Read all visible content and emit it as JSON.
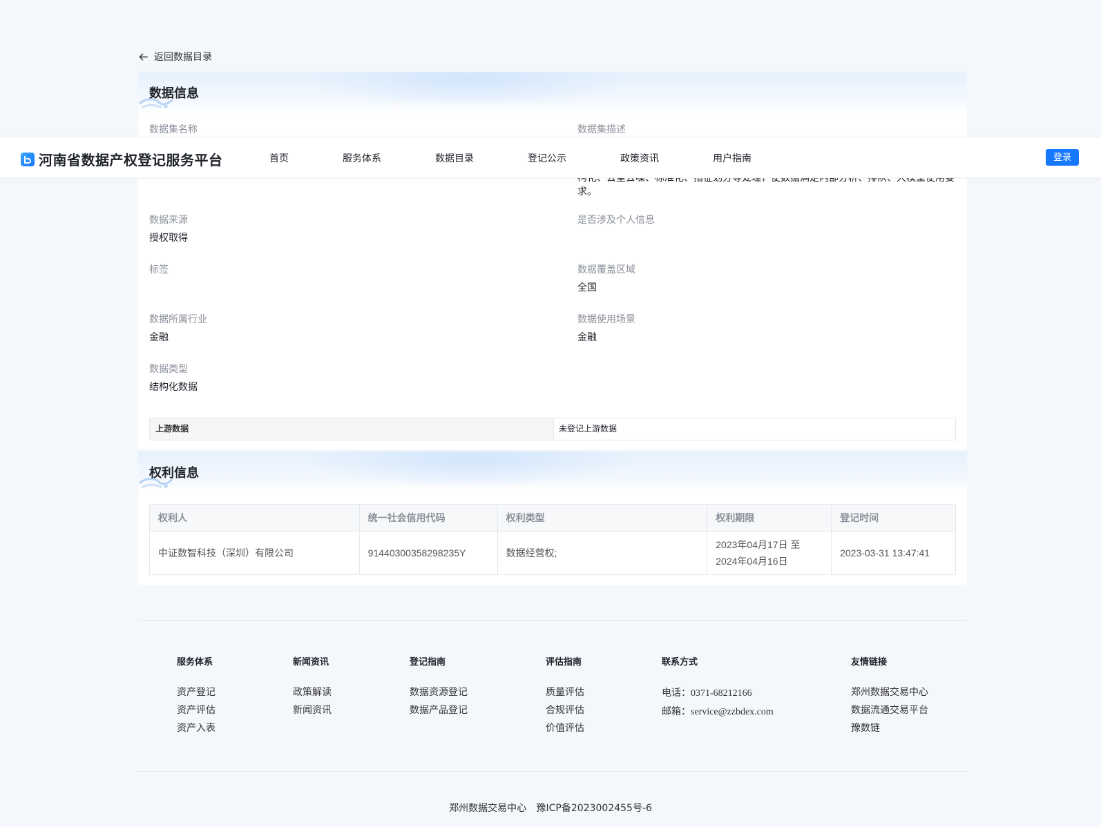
{
  "back_link": "返回数据目录",
  "data_info": {
    "title": "数据信息",
    "fields": {
      "name_label": "数据集名称",
      "desc_label": "数据集描述",
      "desc_text": "构化、去重去噪、标准化、指征划分等处理，使数据满足内部分析、排队、大模型使用要求。",
      "source_label": "数据来源",
      "source_value": "授权取得",
      "personal_label": "是否涉及个人信息",
      "tags_label": "标签",
      "region_label": "数据覆盖区域",
      "region_value": "全国",
      "industry_label": "数据所属行业",
      "industry_value": "金融",
      "scenario_label": "数据使用场景",
      "scenario_value": "金融",
      "type_label": "数据类型",
      "type_value": "结构化数据"
    },
    "upstream": {
      "label": "上游数据",
      "value": "未登记上游数据"
    }
  },
  "rights_info": {
    "title": "权利信息",
    "columns": [
      "权利人",
      "统一社会信用代码",
      "权利类型",
      "权利期限",
      "登记时间"
    ],
    "rows": [
      {
        "holder": "中证数智科技（深圳）有限公司",
        "credit_code": "91440300358298235Y",
        "right_type": "数据经营权;",
        "period_line1": "2023年04月17日 至",
        "period_line2": "2024年04月16日",
        "reg_time": "2023-03-31 13:47:41"
      }
    ]
  },
  "navbar": {
    "brand": "河南省数据产权登记服务平台",
    "items": [
      "首页",
      "服务体系",
      "数据目录",
      "登记公示",
      "政策资讯",
      "用户指南"
    ],
    "login": "登录",
    "accent": "#1677ff"
  },
  "footer": {
    "service": {
      "title": "服务体系",
      "items": [
        "资产登记",
        "资产评估",
        "资产入表"
      ]
    },
    "news": {
      "title": "新闻资讯",
      "items": [
        "政策解读",
        "新闻资讯"
      ]
    },
    "reg_guide": {
      "title": "登记指南",
      "items": [
        "数据资源登记",
        "数据产品登记"
      ]
    },
    "eval_guide": {
      "title": "评估指南",
      "items": [
        "质量评估",
        "合规评估",
        "价值评估"
      ]
    },
    "contact": {
      "title": "联系方式",
      "phone_label": "电话：",
      "phone": "0371-68212166",
      "email_label": "邮箱：",
      "email": "service@zzbdex.com"
    },
    "links": {
      "title": "友情链接",
      "items": [
        "郑州数据交易中心",
        "数据流通交易平台",
        "豫数链"
      ]
    },
    "copyright_org": "郑州数据交易中心",
    "icp": "豫ICP备2023002455号-6"
  }
}
